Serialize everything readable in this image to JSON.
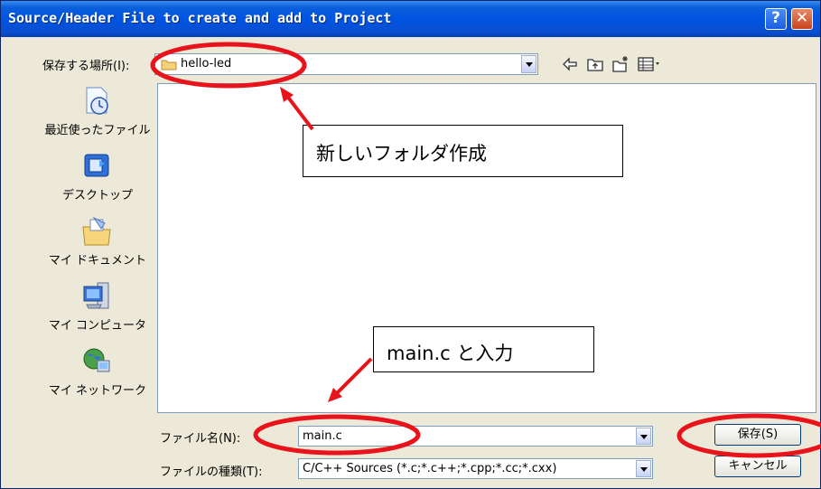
{
  "dialog": {
    "title": "Source/Header File to create and add to Project",
    "help_label": "?",
    "close_label": "✕"
  },
  "location": {
    "label": "保存する場所(I):",
    "value": "hello-led"
  },
  "places": [
    {
      "label": "最近使ったファイル",
      "icon": "recent-icon"
    },
    {
      "label": "デスクトップ",
      "icon": "desktop-icon"
    },
    {
      "label": "マイ ドキュメント",
      "icon": "my-documents-icon"
    },
    {
      "label": "マイ コンピュータ",
      "icon": "my-computer-icon"
    },
    {
      "label": "マイ ネットワーク",
      "icon": "my-network-icon"
    }
  ],
  "filename": {
    "label": "ファイル名(N):",
    "value": "main.c"
  },
  "filetype": {
    "label": "ファイルの種類(T):",
    "value": "C/C++ Sources (*.c;*.c++;*.cpp;*.cc;*.cxx)"
  },
  "buttons": {
    "save": "保存(S)",
    "cancel": "キャンセル"
  },
  "annotations": {
    "new_folder": "新しいフォルダ作成",
    "enter_filename": "main.c と入力"
  },
  "colors": {
    "annotation": "#e8131b",
    "title_bar": "#0054e3"
  }
}
